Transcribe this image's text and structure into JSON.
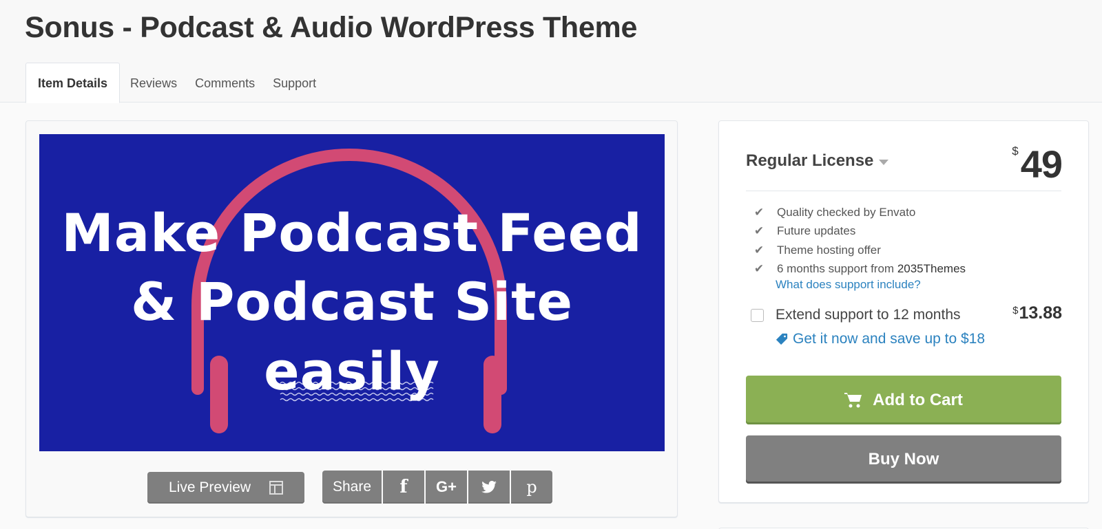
{
  "page": {
    "title": "Sonus - Podcast & Audio WordPress Theme"
  },
  "tabs": [
    {
      "label": "Item Details",
      "active": true
    },
    {
      "label": "Reviews",
      "active": false
    },
    {
      "label": "Comments",
      "active": false
    },
    {
      "label": "Support",
      "active": false
    }
  ],
  "preview": {
    "lines": [
      "Make Podcast Feed",
      "& Podcast Site",
      "easily"
    ],
    "background_color": "#1820a3",
    "headphone_color": "#d24a74",
    "live_preview_label": "Live Preview",
    "live_preview_icon": "layout-icon",
    "share_label": "Share",
    "share_buttons": [
      {
        "name": "facebook",
        "icon": "facebook-icon",
        "glyph": "f"
      },
      {
        "name": "google-plus",
        "icon": "google-plus-icon",
        "glyph": "G+"
      },
      {
        "name": "twitter",
        "icon": "twitter-icon",
        "glyph": "🐦"
      },
      {
        "name": "pinterest",
        "icon": "pinterest-icon",
        "glyph": "p"
      }
    ]
  },
  "purchase": {
    "license": "Regular License",
    "currency": "$",
    "price": "49",
    "features": [
      {
        "text": "Quality checked by Envato",
        "strong": ""
      },
      {
        "text": "Future updates",
        "strong": ""
      },
      {
        "text": "Theme hosting offer",
        "strong": ""
      },
      {
        "text": "6 months support from ",
        "strong": "2035Themes"
      }
    ],
    "support_link": "What does support include?",
    "extend": {
      "label": "Extend support to 12 months",
      "checked": false,
      "currency": "$",
      "price": "13.88",
      "save_link": "Get it now and save up to $18"
    },
    "add_to_cart": "Add to Cart",
    "buy_now": "Buy Now",
    "colors": {
      "add_to_cart": "#8bb054",
      "buy_now": "#808080",
      "link": "#2b82bf"
    }
  }
}
